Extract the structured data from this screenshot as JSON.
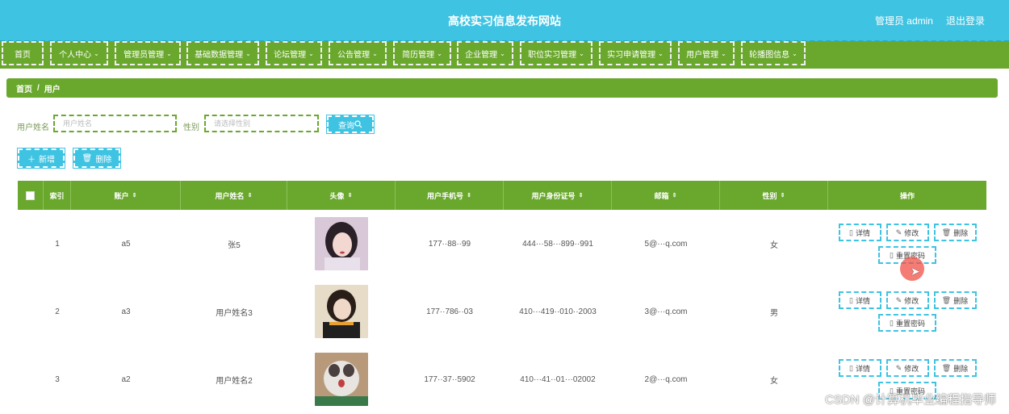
{
  "header": {
    "title": "高校实习信息发布网站",
    "user_label": "管理员 admin",
    "logout_label": "退出登录"
  },
  "nav": [
    {
      "label": "首页",
      "has_menu": false
    },
    {
      "label": "个人中心",
      "has_menu": true
    },
    {
      "label": "管理员管理",
      "has_menu": true
    },
    {
      "label": "基础数据管理",
      "has_menu": true
    },
    {
      "label": "论坛管理",
      "has_menu": true
    },
    {
      "label": "公告管理",
      "has_menu": true
    },
    {
      "label": "简历管理",
      "has_menu": true
    },
    {
      "label": "企业管理",
      "has_menu": true
    },
    {
      "label": "职位实习管理",
      "has_menu": true
    },
    {
      "label": "实习申请管理",
      "has_menu": true
    },
    {
      "label": "用户管理",
      "has_menu": true
    },
    {
      "label": "轮播图信息",
      "has_menu": true
    }
  ],
  "breadcrumb": {
    "home": "首页",
    "sep": "/",
    "current": "用户"
  },
  "search": {
    "name_label": "用户姓名",
    "name_placeholder": "用户姓名",
    "gender_label": "性别",
    "gender_placeholder": "请选择性别",
    "query_label": "查询"
  },
  "toolbar": {
    "add_label": "新增",
    "delete_label": "删除"
  },
  "table": {
    "columns": [
      "",
      "索引",
      "账户",
      "用户姓名",
      "头像",
      "用户手机号",
      "用户身份证号",
      "邮箱",
      "性别",
      "操作"
    ],
    "sortable": [
      false,
      false,
      true,
      true,
      true,
      true,
      true,
      true,
      true,
      false
    ],
    "rows": [
      {
        "index": "1",
        "account": "a5",
        "name": "张5",
        "phone": "177··88··99",
        "id_card": "444···58···899··991",
        "email": "5@···q.com",
        "gender": "女"
      },
      {
        "index": "2",
        "account": "a3",
        "name": "用户姓名3",
        "phone": "177··786··03",
        "id_card": "410···419··010··2003",
        "email": "3@···q.com",
        "gender": "男"
      },
      {
        "index": "3",
        "account": "a2",
        "name": "用户姓名2",
        "phone": "177··37··5902",
        "id_card": "410···41··01···02002",
        "email": "2@···q.com",
        "gender": "女"
      }
    ],
    "actions": {
      "detail": "详情",
      "edit": "修改",
      "delete": "删除",
      "reset": "重置密码"
    }
  },
  "watermark": "CSDN @计算机毕业编程指导师",
  "colors": {
    "primary_green": "#6aa82d",
    "accent_cyan": "#3fc3e2"
  }
}
